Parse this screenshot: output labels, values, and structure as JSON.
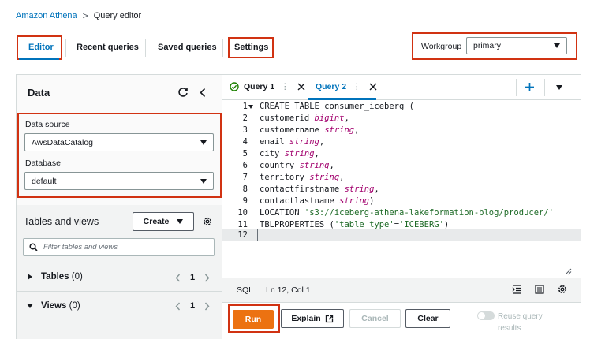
{
  "breadcrumb": {
    "root": "Amazon Athena",
    "separator": ">",
    "current": "Query editor"
  },
  "top_tabs": {
    "editor": "Editor",
    "recent": "Recent queries",
    "saved": "Saved queries",
    "settings": "Settings"
  },
  "workgroup": {
    "label": "Workgroup",
    "value": "primary"
  },
  "data_panel": {
    "title": "Data",
    "data_source_label": "Data source",
    "data_source_value": "AwsDataCatalog",
    "database_label": "Database",
    "database_value": "default",
    "tables_views_title": "Tables and views",
    "create_label": "Create",
    "filter_placeholder": "Filter tables and views",
    "tables_label": "Tables",
    "tables_count": "(0)",
    "tables_page": "1",
    "views_label": "Views",
    "views_count": "(0)",
    "views_page": "1"
  },
  "editor_tabs": [
    {
      "label": "Query 1",
      "status": "success"
    },
    {
      "label": "Query 2",
      "status": "active"
    }
  ],
  "code_lines": [
    {
      "n": "1",
      "text": "CREATE TABLE consumer_iceberg ("
    },
    {
      "n": "2",
      "name": "customerid ",
      "type": "bigint",
      "end": ","
    },
    {
      "n": "3",
      "name": "customername ",
      "type": "string",
      "end": ","
    },
    {
      "n": "4",
      "name": "email ",
      "type": "string",
      "end": ","
    },
    {
      "n": "5",
      "name": "city ",
      "type": "string",
      "end": ","
    },
    {
      "n": "6",
      "name": "country ",
      "type": "string",
      "end": ","
    },
    {
      "n": "7",
      "name": "territory ",
      "type": "string",
      "end": ","
    },
    {
      "n": "8",
      "name": "contactfirstname ",
      "type": "string",
      "end": ","
    },
    {
      "n": "9",
      "name": "contactlastname ",
      "type": "string",
      "end": ")"
    },
    {
      "n": "10",
      "kw": "LOCATION ",
      "str": "'s3://iceberg-athena-lakeformation-blog/producer/'"
    },
    {
      "n": "11",
      "kw": "TBLPROPERTIES (",
      "str": "'table_type'",
      "mid": "=",
      "str2": "'ICEBERG'",
      "end": ")"
    },
    {
      "n": "12",
      "text": ""
    }
  ],
  "status_bar": {
    "language": "SQL",
    "cursor": "Ln 12, Col 1"
  },
  "actions": {
    "run": "Run",
    "explain": "Explain",
    "cancel": "Cancel",
    "clear": "Clear",
    "reuse_line1": "Reuse query",
    "reuse_line2": "results"
  },
  "colors": {
    "accent": "#0073bb",
    "run": "#ec7211",
    "highlight_box": "#d13212",
    "success": "#1d8102"
  }
}
